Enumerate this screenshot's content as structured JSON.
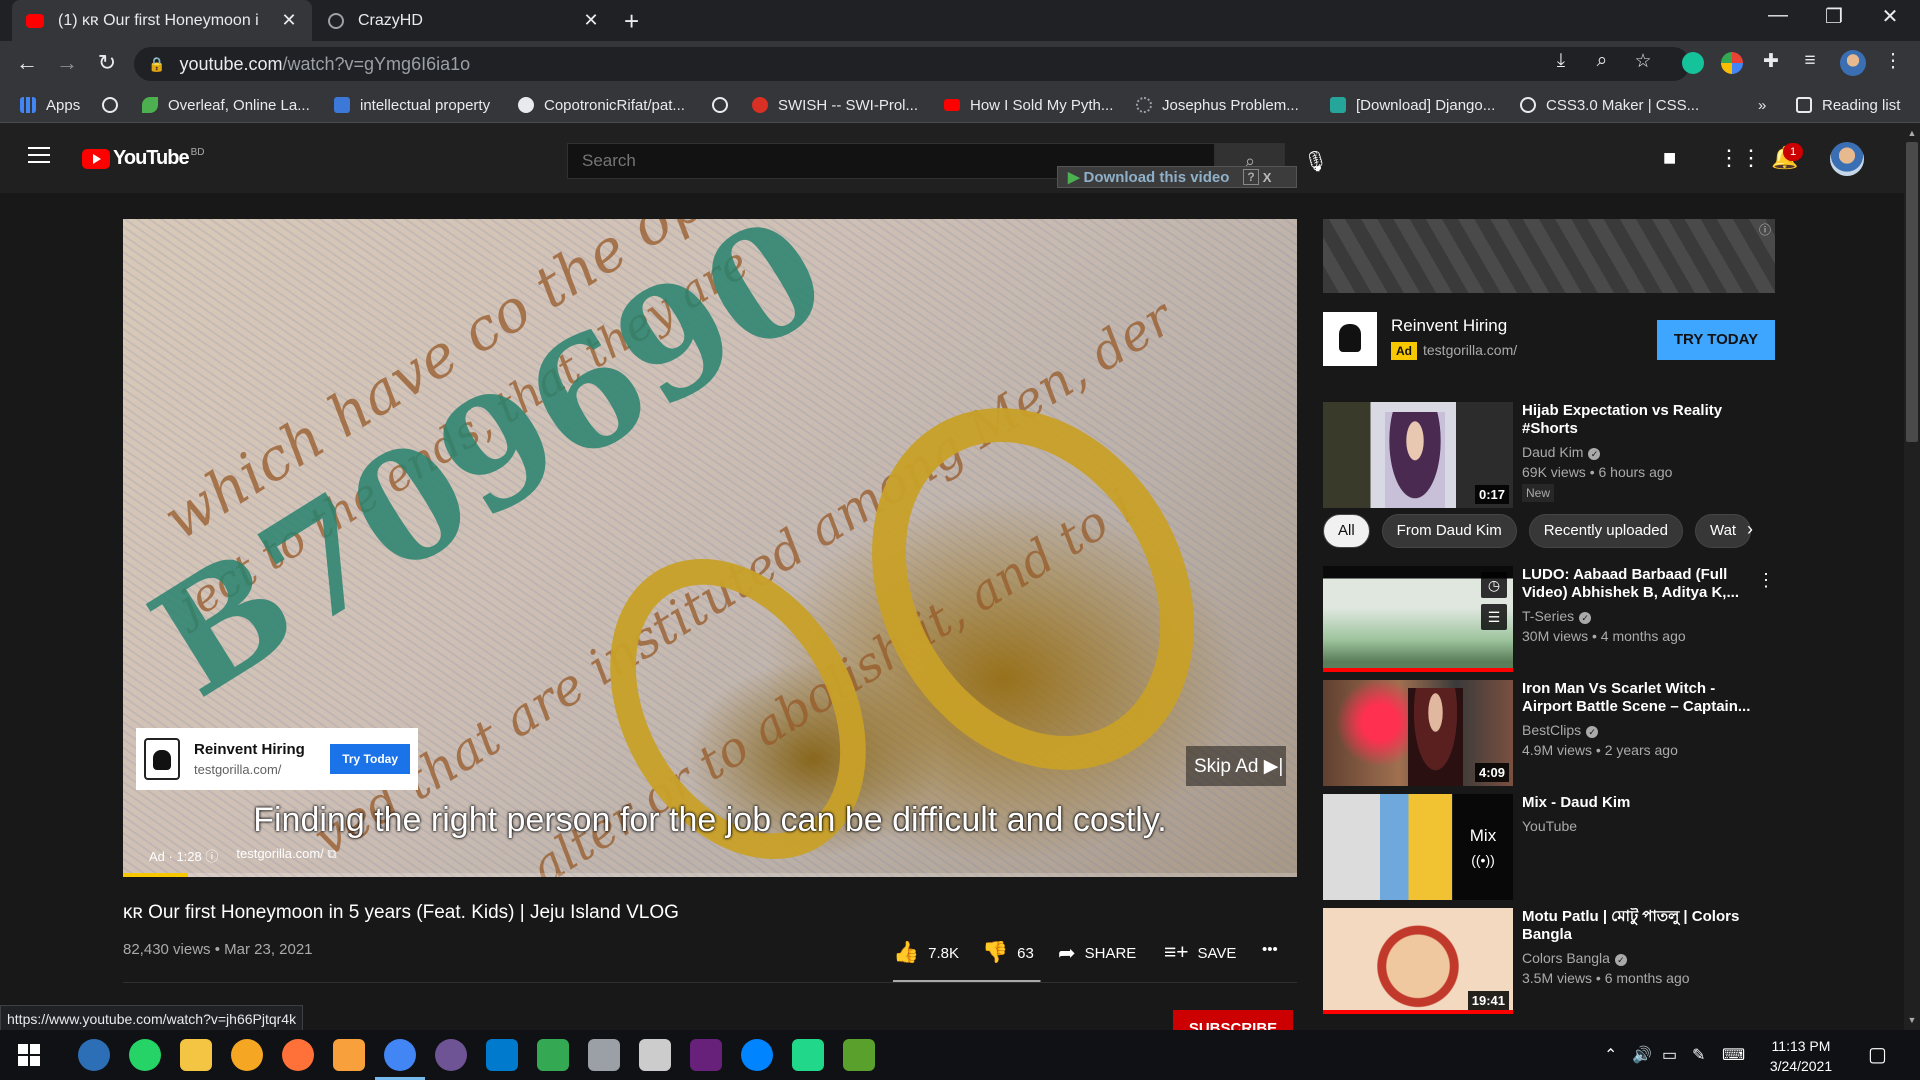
{
  "browser": {
    "tabs": [
      {
        "title": "(1) ᴋʀ Our first Honeymoon i",
        "active": true
      },
      {
        "title": "CrazyHD",
        "active": false
      }
    ],
    "url_host": "youtube.com",
    "url_path": "/watch?v=gYmg6I6ia1o",
    "bookmarks": [
      {
        "label": "Apps",
        "color": "#4285f4"
      },
      {
        "label": "",
        "color": "#9aa0a6"
      },
      {
        "label": "Overleaf, Online La...",
        "color": "#4caf50"
      },
      {
        "label": "intellectual property",
        "color": "#3c78d8"
      },
      {
        "label": "CopotronicRifat/pat...",
        "color": "#e8eaed"
      },
      {
        "label": "",
        "color": "#9aa0a6"
      },
      {
        "label": "SWISH -- SWI-Prol...",
        "color": "#d93025"
      },
      {
        "label": "How I Sold My Pyth...",
        "color": "#ff0000"
      },
      {
        "label": "Josephus Problem...",
        "color": "#5f6368"
      },
      {
        "label": "[Download] Django...",
        "color": "#26a69a"
      },
      {
        "label": "CSS3.0 Maker | CSS...",
        "color": "#9aa0a6"
      }
    ],
    "bookmarks_overflow": "»",
    "reading_list": "Reading list",
    "status_url": "https://www.youtube.com/watch?v=jh66Pjtqr4k"
  },
  "youtube": {
    "logo_text": "YouTube",
    "country_code": "BD",
    "search_placeholder": "Search",
    "download_bar": "Download this video",
    "download_help": "?",
    "download_close": "X",
    "notification_count": "1"
  },
  "player": {
    "banknote_number": "B709690",
    "banknote_script_1": "which have co the opinions of",
    "banknote_script_2": "ject to the ends, that they are",
    "banknote_script_3": "ved that are instituted among Men, der",
    "banknote_script_4": "alter or to abolish it, and to i",
    "ad_overlay": {
      "title": "Reinvent Hiring",
      "url": "testgorilla.com/",
      "button": "Try Today"
    },
    "skip_ad": "Skip Ad ▶|",
    "caption": "Finding the right person for the job can be difficult and costly.",
    "ad_label": "Ad · 1:28 ⓘ",
    "ad_domain": "testgorilla.com/ ⧉",
    "ad_progress": 0.055
  },
  "video": {
    "title": "ᴋʀ Our first Honeymoon in 5 years (Feat. Kids) | Jeju Island VLOG",
    "views_date": "82,430 views • Mar 23, 2021",
    "likes": "7.8K",
    "dislikes": "63",
    "like_ratio": 0.99,
    "share": "SHARE",
    "save": "SAVE",
    "more": "•••",
    "subscribe": "SUBSCRIBE"
  },
  "sidebar": {
    "banner_info": "ⓘ",
    "ad": {
      "title": "Reinvent Hiring",
      "badge": "Ad",
      "url": "testgorilla.com/",
      "button": "TRY TODAY"
    },
    "chips": [
      "All",
      "From Daud Kim",
      "Recently uploaded",
      "Wat"
    ],
    "recommendations": [
      {
        "title": "Hijab Expectation vs Reality #Shorts",
        "channel": "Daud Kim",
        "verified": true,
        "meta": "69K views • 6 hours ago",
        "badge": "New",
        "duration": "0:17"
      },
      {
        "title": "LUDO: Aabaad Barbaad (Full Video) Abhishek B, Aditya K,...",
        "channel": "T-Series",
        "verified": true,
        "meta": "30M views • 4 months ago",
        "badge": "",
        "duration": ""
      },
      {
        "title": "Iron Man Vs Scarlet Witch - Airport Battle Scene – Captain...",
        "channel": "BestClips",
        "verified": true,
        "meta": "4.9M views • 2 years ago",
        "badge": "",
        "duration": "4:09"
      },
      {
        "title": "Mix - Daud Kim",
        "channel": "YouTube",
        "verified": false,
        "meta": "",
        "badge": "",
        "duration": "",
        "mix_label": "Mix"
      },
      {
        "title": "Motu Patlu | মোটু পাতলু | Colors Bangla",
        "channel": "Colors Bangla",
        "verified": true,
        "meta": "3.5M views • 6 months ago",
        "badge": "",
        "duration": "19:41"
      }
    ]
  },
  "taskbar": {
    "time": "11:13 PM",
    "date": "3/24/2021",
    "apps": [
      {
        "name": "eclipse",
        "color": "#2c6fb7"
      },
      {
        "name": "whatsapp",
        "color": "#25d366"
      },
      {
        "name": "file-explorer",
        "color": "#f4c542"
      },
      {
        "name": "vpn",
        "color": "#f5a623"
      },
      {
        "name": "firefox",
        "color": "#ff7139"
      },
      {
        "name": "scratch",
        "color": "#f7a03c"
      },
      {
        "name": "chrome",
        "color": "#4285f4"
      },
      {
        "name": "github-desktop",
        "color": "#6e5494"
      },
      {
        "name": "vscode",
        "color": "#007acc"
      },
      {
        "name": "earth",
        "color": "#34a853"
      },
      {
        "name": "app-balloon",
        "color": "#9aa0a6"
      },
      {
        "name": "inkscape",
        "color": "#cccccc"
      },
      {
        "name": "visual-studio",
        "color": "#68217a"
      },
      {
        "name": "messenger",
        "color": "#0084ff"
      },
      {
        "name": "pycharm",
        "color": "#21d789"
      },
      {
        "name": "spreadsheet",
        "color": "#5aa02c"
      }
    ]
  }
}
